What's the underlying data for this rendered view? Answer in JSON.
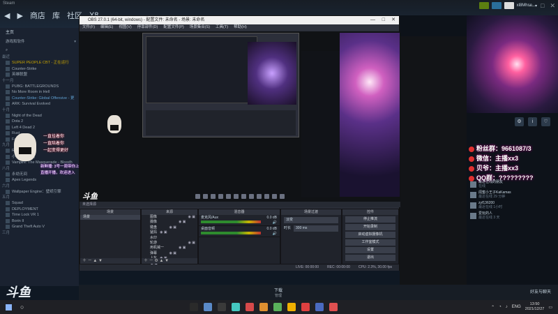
{
  "steam": {
    "nav": [
      "商店",
      "库",
      "社区",
      "X8"
    ],
    "logo_text": "Steam",
    "user": "xl8Mhse",
    "window_controls": [
      "—",
      "□",
      "✕"
    ],
    "home_label": "主页",
    "filter_label": "游戏和软件",
    "sections": [
      {
        "label": "最近",
        "games": [
          {
            "name": "SUPER PEOPLE CBT - 正在运行",
            "style": "hl"
          },
          {
            "name": "Counter-Strike",
            "style": ""
          },
          {
            "name": "英雄联盟",
            "style": ""
          }
        ]
      },
      {
        "label": "十一月",
        "games": [
          {
            "name": "PUBG: BATTLEGROUNDS",
            "style": ""
          },
          {
            "name": "No More Room in Hell",
            "style": ""
          },
          {
            "name": "Counter-Strike: Global Offensive - 更",
            "style": "blue"
          },
          {
            "name": "ARK: Survival Evolved",
            "style": ""
          }
        ]
      },
      {
        "label": "十月",
        "games": [
          {
            "name": "Night of the Dead",
            "style": ""
          },
          {
            "name": "Dota 2",
            "style": ""
          },
          {
            "name": "Left 4 Dead 2",
            "style": ""
          },
          {
            "name": "Rust",
            "style": ""
          },
          {
            "name": "Fall Guys",
            "style": ""
          }
        ]
      },
      {
        "label": "九月",
        "games": [
          {
            "name": "Rise of the...",
            "style": ""
          },
          {
            "name": "小黑屋的游戏",
            "style": ""
          },
          {
            "name": "Vampire: The Masquerade - Bloodh",
            "style": ""
          }
        ]
      },
      {
        "label": "八月",
        "games": [
          {
            "name": "永劫无间",
            "style": ""
          },
          {
            "name": "Apex Legends",
            "style": ""
          }
        ]
      },
      {
        "label": "六月",
        "games": [
          {
            "name": "Wallpaper Engine：壁纸引擎",
            "style": ""
          }
        ]
      },
      {
        "label": "五月",
        "games": [
          {
            "name": "Squad",
            "style": ""
          },
          {
            "name": "DEPLOYMENT",
            "style": ""
          },
          {
            "name": "Time Lock VR 1",
            "style": ""
          },
          {
            "name": "Borin II",
            "style": ""
          },
          {
            "name": "Grand Theft Auto V",
            "style": ""
          }
        ]
      },
      {
        "label": "三月",
        "games": []
      }
    ]
  },
  "overlay_left": {
    "lines": [
      "一直挂着你",
      "一直陪着你",
      "一起变得更好",
      "新鲜播: 3号一周带你上分",
      "直播开播，欢迎进入"
    ]
  },
  "watermark": "斗鱼",
  "obs": {
    "title": "OBS 27.0.1 (64-bit, windows) - 配置文件: 未命名 - 场景: 未命名",
    "menu": [
      "文件(F)",
      "编辑(E)",
      "视图(V)",
      "停靠部件(D)",
      "配置文件(P)",
      "场景集合(S)",
      "工具(T)",
      "帮助(H)"
    ],
    "scene_bar": "未选择源",
    "panels": {
      "scenes": {
        "title": "场景",
        "items": [
          "场景"
        ]
      },
      "sources": {
        "title": "来源",
        "items": [
          "图像",
          "摄像",
          "键盘",
          "猛犸",
          "水印",
          "轮游",
          "用机械一",
          "弹幕",
          "上车"
        ]
      },
      "mixer": {
        "title": "混音器",
        "channels": [
          {
            "name": "麦克风/Aux",
            "db": "0.0 dB"
          },
          {
            "name": "桌面音频",
            "db": "0.0 dB"
          }
        ]
      },
      "transitions": {
        "title": "场景过渡",
        "type": "淡变",
        "duration_label": "时长",
        "duration": "300 ms"
      },
      "controls": {
        "title": "控件",
        "buttons": [
          "停止推流",
          "开始录制",
          "启动虚拟摄像机",
          "工作室模式",
          "设置",
          "退出"
        ]
      }
    },
    "status": [
      "LIVE: 00:00:00",
      "REC: 00:00:00",
      "CPU: 2.3%, 30.00 fps"
    ]
  },
  "stream_info": [
    {
      "label": "粉丝群",
      "value": "9661087/3"
    },
    {
      "label": "微信",
      "value": "主播xx3"
    },
    {
      "label": "贝爷",
      "value": "主播xx3"
    },
    {
      "label": "QQ群",
      "value": "?????????"
    }
  ],
  "chat": [
    {
      "name": "最近在线的朋友",
      "status": "在线"
    },
    {
      "name": "闺蜜小王子KaKamas",
      "status": "最近在线 29 分钟"
    },
    {
      "name": "zyf136200",
      "status": "最近在线 1小时"
    },
    {
      "name": "爱玩的人",
      "status": "最近在线 3 天"
    }
  ],
  "steam_bottom": {
    "center": "下载",
    "center_sub": "管理",
    "right": "好友与聊天"
  },
  "taskbar": {
    "lang": "ENG",
    "time": "13:50",
    "date": "2021/12/27",
    "app_colors": [
      "#2a2a2a",
      "#5a8ac8",
      "#3a3a3a",
      "#45c8c0",
      "#d84a4a",
      "#e09030",
      "#5ab05a",
      "#f0b000",
      "#e04040",
      "#4a6ac0",
      "#e05050"
    ]
  }
}
